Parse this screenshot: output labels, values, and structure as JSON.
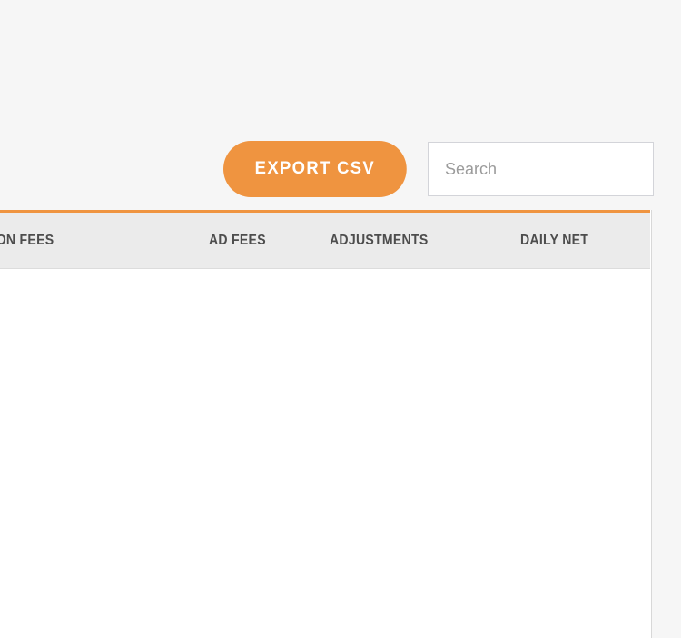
{
  "theme": {
    "accent": "#ef9440",
    "page_background": "#f6f6f6",
    "header_background": "#ebebeb",
    "header_text": "#4d4d4d",
    "table_background": "#ffffff",
    "border": "#d3d4d9",
    "placeholder_text": "#9b9b9b"
  },
  "toolbar": {
    "export_label": "EXPORT CSV",
    "search": {
      "placeholder": "Search",
      "value": ""
    }
  },
  "table": {
    "columns": [
      {
        "label": "TRANSACTION FEES"
      },
      {
        "label": "AD FEES"
      },
      {
        "label": "ADJUSTMENTS"
      },
      {
        "label": "DAILY NET"
      }
    ],
    "rows": []
  }
}
